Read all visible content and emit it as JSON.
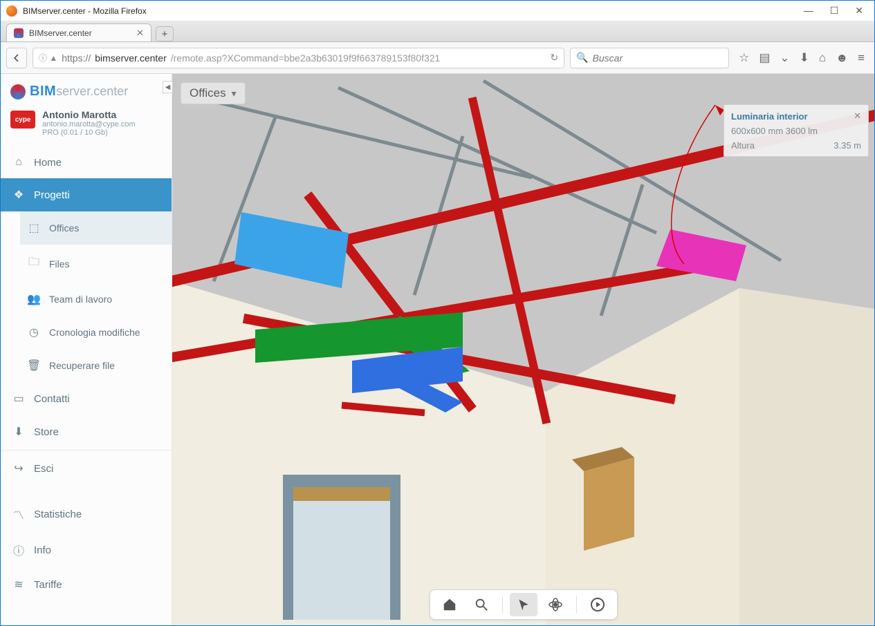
{
  "window": {
    "title": "BIMserver.center - Mozilla Firefox"
  },
  "tab": {
    "title": "BIMserver.center"
  },
  "url": {
    "protocol": "https://",
    "host": "bimserver.center",
    "path": "/remote.asp?XCommand=bbe2a3b63019f9f663789153f80f321"
  },
  "search": {
    "placeholder": "Buscar"
  },
  "logo": {
    "bim": "BIM",
    "rest": "server.center"
  },
  "user": {
    "name": "Antonio Marotta",
    "email": "antonio.marotta@cype.com",
    "quota": "PRO (0.01 / 10 Gb)",
    "badge": "cype"
  },
  "nav": {
    "home": "Home",
    "progetti": "Progetti",
    "offices": "Offices",
    "files": "Files",
    "team": "Team di lavoro",
    "cronologia": "Cronologia modifiche",
    "recuperare": "Recuperare file",
    "contatti": "Contatti",
    "store": "Store",
    "esci": "Esci",
    "statistiche": "Statistiche",
    "info": "Info",
    "tariffe": "Tariffe"
  },
  "project_dropdown": {
    "label": "Offices"
  },
  "info_panel": {
    "title": "Luminaria interior",
    "spec": "600x600 mm 3600 lm",
    "altura_label": "Altura",
    "altura_value": "3.35 m"
  }
}
